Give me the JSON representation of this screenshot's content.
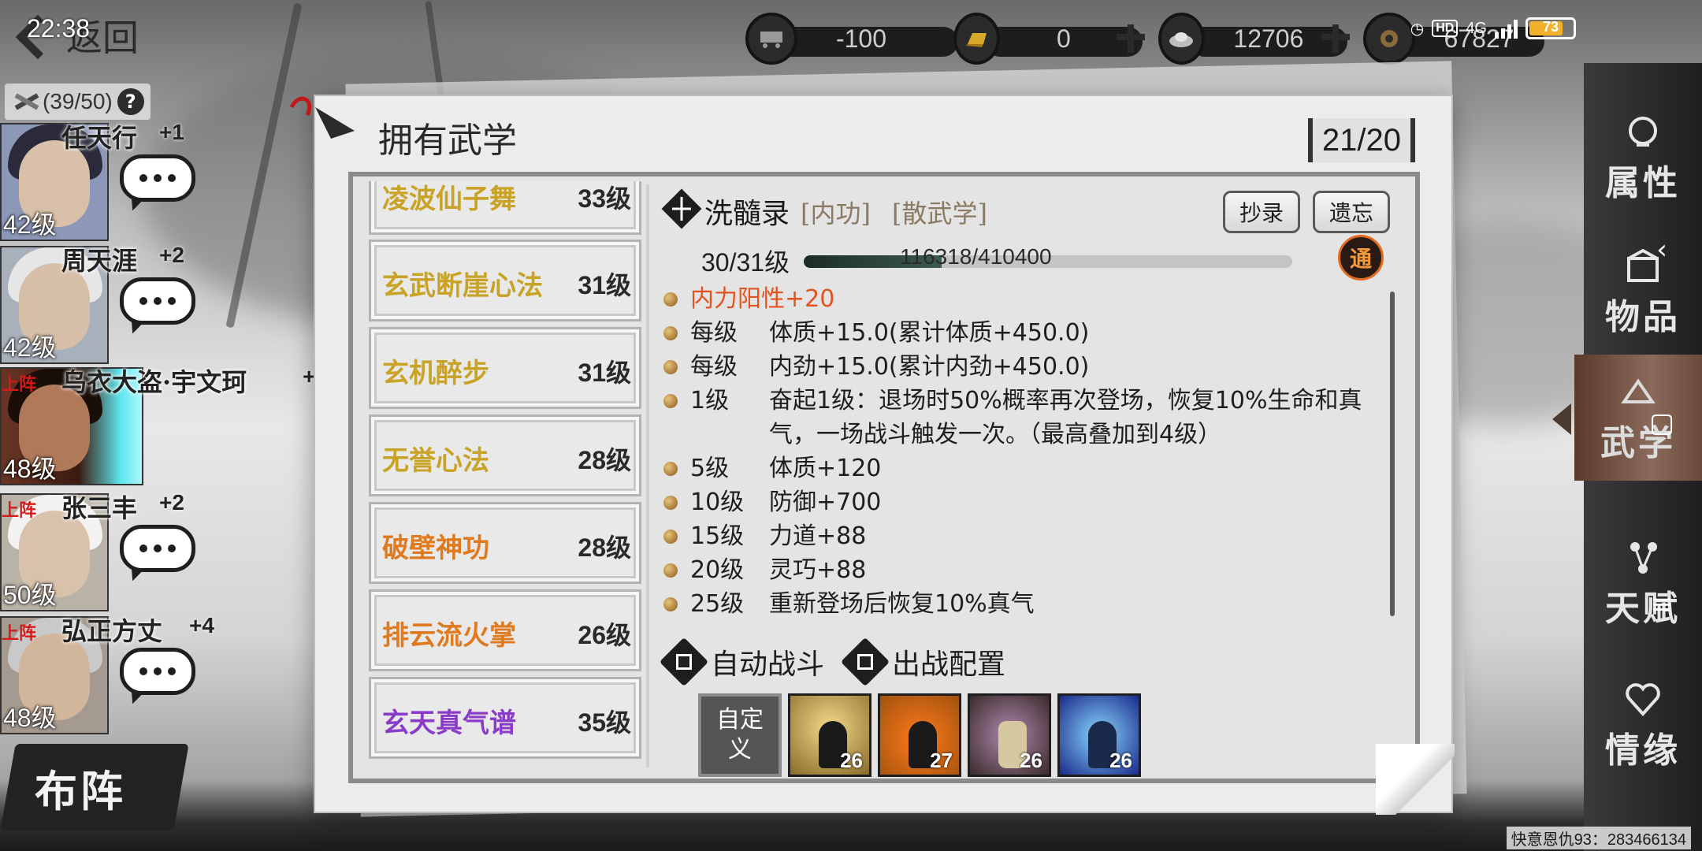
{
  "top_bar": {
    "back_label": "返回",
    "time": "22:38",
    "currencies": [
      {
        "icon": "cart-icon",
        "value": "-100"
      },
      {
        "icon": "gold-bar-icon",
        "value": "0"
      },
      {
        "icon": "silver-ingot-icon",
        "value": "12706"
      },
      {
        "icon": "coin-pouch-icon",
        "value": "67827"
      }
    ],
    "status": {
      "hd": "HD",
      "network": "4G",
      "battery": "73"
    }
  },
  "roster": {
    "count": "(39/50)",
    "help": "?",
    "onstage_label": "上阵",
    "heroes": [
      {
        "name": "任天行",
        "bonus": "+1",
        "level": "42级",
        "onstage": false
      },
      {
        "name": "周天涯",
        "bonus": "+2",
        "level": "42级",
        "onstage": false
      },
      {
        "name": "乌衣大盗·宇文珂",
        "bonus": "+",
        "level": "48级",
        "onstage": true
      },
      {
        "name": "张三丰",
        "bonus": "+2",
        "level": "50级",
        "onstage": true
      },
      {
        "name": "弘正方丈",
        "bonus": "+4",
        "level": "48级",
        "onstage": true
      }
    ],
    "formation_label": "布阵"
  },
  "panel": {
    "title": "拥有武学",
    "count": "21/20",
    "skills": [
      {
        "name": "凌波仙子舞",
        "level": "33级",
        "color": "#c8a325"
      },
      {
        "name": "玄武断崖心法",
        "level": "31级",
        "color": "#c8a325"
      },
      {
        "name": "玄机醉步",
        "level": "31级",
        "color": "#c8a325"
      },
      {
        "name": "无誉心法",
        "level": "28级",
        "color": "#c8a325"
      },
      {
        "name": "破壁神功",
        "level": "28级",
        "color": "#e07a1e"
      },
      {
        "name": "排云流火掌",
        "level": "26级",
        "color": "#e07a1e"
      },
      {
        "name": "玄天真气谱",
        "level": "35级",
        "color": "#8a3cc8"
      }
    ],
    "detail": {
      "name": "洗髓录",
      "tags": [
        "[内功]",
        "[散武学]"
      ],
      "copy_button": "抄录",
      "forget_button": "遗忘",
      "level": "30/31级",
      "exp": "116318/410400",
      "exp_ratio": 0.283,
      "mastery_badge": "通",
      "headline": "内力阳性+20",
      "effects": [
        {
          "req": "每级",
          "text": "体质+15.0(累计体质+450.0)"
        },
        {
          "req": "每级",
          "text": "内劲+15.0(累计内劲+450.0)"
        },
        {
          "req": "1级",
          "text": "奋起1级：退场时50%概率再次登场，恢复10%生命和真气，一场战斗触发一次。（最高叠加到4级）"
        },
        {
          "req": "5级",
          "text": "体质+120"
        },
        {
          "req": "10级",
          "text": "防御+700"
        },
        {
          "req": "15级",
          "text": "力道+88"
        },
        {
          "req": "20级",
          "text": "灵巧+88"
        },
        {
          "req": "25级",
          "text": "重新登场后恢复10%真气"
        }
      ],
      "auto_battle": "自动战斗",
      "battle_config": "出战配置",
      "slots": [
        {
          "type": "custom",
          "label": "自定义"
        },
        {
          "type": "move",
          "level": "26"
        },
        {
          "type": "move",
          "level": "27"
        },
        {
          "type": "move",
          "level": "26"
        },
        {
          "type": "move",
          "level": "26"
        }
      ]
    }
  },
  "right_nav": [
    {
      "label": "属性",
      "icon": "attributes-icon"
    },
    {
      "label": "物品",
      "icon": "items-icon"
    },
    {
      "label": "武学",
      "icon": "martial-arts-icon",
      "active": true
    },
    {
      "label": "天赋",
      "icon": "talent-icon"
    },
    {
      "label": "情缘",
      "icon": "bond-icon"
    }
  ],
  "footer": "快意恩仇93：283466134"
}
